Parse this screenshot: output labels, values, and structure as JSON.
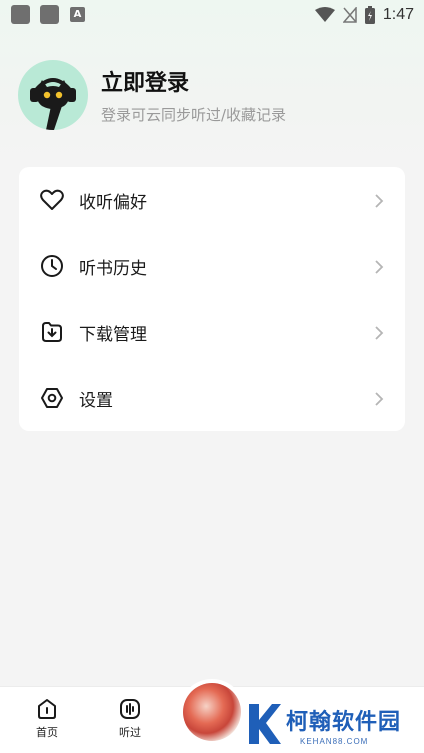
{
  "status_bar": {
    "time": "1:47",
    "left_badge": "A"
  },
  "profile": {
    "title": "立即登录",
    "subtitle": "登录可云同步听过/收藏记录"
  },
  "menu": {
    "items": [
      {
        "label": "收听偏好",
        "icon": "heart-icon"
      },
      {
        "label": "听书历史",
        "icon": "clock-icon"
      },
      {
        "label": "下载管理",
        "icon": "download-icon"
      },
      {
        "label": "设置",
        "icon": "settings-icon"
      }
    ]
  },
  "bottom_nav": {
    "items": [
      {
        "label": "首页",
        "icon": "home-icon"
      },
      {
        "label": "听过",
        "icon": "listened-icon"
      }
    ]
  },
  "watermark": {
    "text": "柯翰软件园",
    "sub": "KEHAN88.COM"
  }
}
